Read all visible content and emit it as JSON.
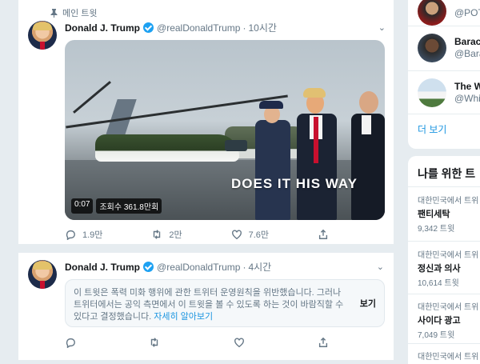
{
  "tweets": [
    {
      "pinned_label": "메인 트윗",
      "name": "Donald J. Trump",
      "handle": "@realDonaldTrump",
      "time": "10시간",
      "video": {
        "overlay_text": "DOES IT HIS WAY",
        "duration": "0:07",
        "views": "조회수 361.8만회"
      },
      "actions": {
        "replies": "1.9만",
        "retweets": "2만",
        "likes": "7.6만"
      }
    },
    {
      "name": "Donald J. Trump",
      "handle": "@realDonaldTrump",
      "time": "4시간",
      "notice": {
        "text": "이 트윗은 폭력 미화 행위에 관한 트위터 운영원칙을 위반했습니다. 그러나 트위터에서는 공익 측면에서 이 트윗을 볼 수 있도록 하는 것이 바람직할 수 있다고 결정했습니다.",
        "link": "자세히 알아보기",
        "view_label": "보기"
      }
    }
  ],
  "who_to_follow": {
    "items": [
      {
        "name": "",
        "handle": "@POT"
      },
      {
        "name": "Barac",
        "handle": "@Bara"
      },
      {
        "name": "The W",
        "handle": "@Whi"
      }
    ],
    "more_label": "더 보기"
  },
  "trends": {
    "title": "나를 위한 트",
    "items": [
      {
        "location": "대한민국에서 트위",
        "name": "팬티세탁",
        "count": "9,342 트윗"
      },
      {
        "location": "대한민국에서 트위",
        "name": "정신과 의사",
        "count": "10,614 트윗"
      },
      {
        "location": "대한민국에서 트위",
        "name": "사이다 광고",
        "count": "7,049 트윗"
      },
      {
        "location": "대한민국에서 트위",
        "name": "",
        "count": ""
      }
    ]
  },
  "colors": {
    "accent": "#1da1f2",
    "link": "#1b95e0",
    "muted": "#657786",
    "background": "#e6ecf0"
  },
  "icons": [
    "pin-icon",
    "verified-icon",
    "chevron-down-icon",
    "reply-icon",
    "retweet-icon",
    "like-icon",
    "share-icon"
  ]
}
